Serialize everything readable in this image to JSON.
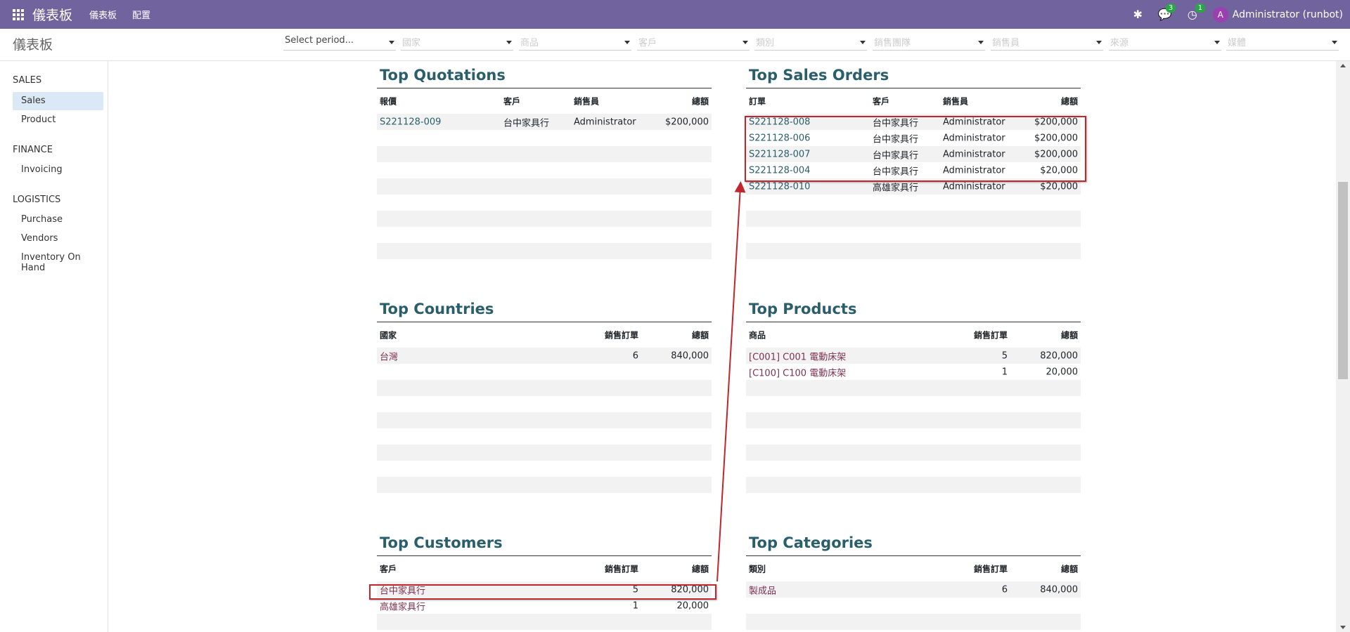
{
  "navbar": {
    "brand": "儀表板",
    "menu1": "儀表板",
    "menu2": "配置",
    "messages_count": "3",
    "activities_count": "1",
    "avatar_letter": "A",
    "user": "Administrator (runbot)"
  },
  "subbar": {
    "title": "儀表板",
    "filters": [
      "Select period...",
      "國家",
      "商品",
      "客戶",
      "類別",
      "銷售團隊",
      "銷售員",
      "來源",
      "媒體"
    ]
  },
  "sidebar": {
    "sections": [
      {
        "title": "SALES",
        "items": [
          "Sales",
          "Product"
        ]
      },
      {
        "title": "FINANCE",
        "items": [
          "Invoicing"
        ]
      },
      {
        "title": "LOGISTICS",
        "items": [
          "Purchase",
          "Vendors",
          "Inventory On Hand"
        ]
      }
    ]
  },
  "top_quotations": {
    "title": "Top Quotations",
    "headers": [
      "報價",
      "客戶",
      "銷售員",
      "總額"
    ],
    "rows": [
      [
        "S221128-009",
        "台中家具行",
        "Administrator",
        "$200,000"
      ]
    ]
  },
  "top_sales_orders": {
    "title": "Top Sales Orders",
    "headers": [
      "訂單",
      "客戶",
      "銷售員",
      "總額"
    ],
    "rows": [
      [
        "S221128-008",
        "台中家具行",
        "Administrator",
        "$200,000"
      ],
      [
        "S221128-006",
        "台中家具行",
        "Administrator",
        "$200,000"
      ],
      [
        "S221128-007",
        "台中家具行",
        "Administrator",
        "$200,000"
      ],
      [
        "S221128-004",
        "台中家具行",
        "Administrator",
        "$20,000"
      ],
      [
        "S221128-010",
        "高雄家具行",
        "Administrator",
        "$20,000"
      ]
    ]
  },
  "top_countries": {
    "title": "Top Countries",
    "headers": [
      "國家",
      "銷售訂單",
      "總額"
    ],
    "rows": [
      [
        "台灣",
        "6",
        "840,000"
      ]
    ]
  },
  "top_products": {
    "title": "Top Products",
    "headers": [
      "商品",
      "銷售訂單",
      "總額"
    ],
    "rows": [
      [
        "[C001] C001 電動床架",
        "5",
        "820,000"
      ],
      [
        "[C100] C100 電動床架",
        "1",
        "20,000"
      ]
    ]
  },
  "top_customers": {
    "title": "Top Customers",
    "headers": [
      "客戶",
      "銷售訂單",
      "總額"
    ],
    "rows": [
      [
        "台中家具行",
        "5",
        "820,000"
      ],
      [
        "高雄家具行",
        "1",
        "20,000"
      ]
    ]
  },
  "top_categories": {
    "title": "Top Categories",
    "headers": [
      "類別",
      "銷售訂單",
      "總額"
    ],
    "rows": [
      [
        "製成品",
        "6",
        "840,000"
      ]
    ]
  },
  "colors": {
    "navbar": "#71639e",
    "heading": "#2a5e6b",
    "link_plum": "#7c3150",
    "highlight_box": "#c0262d"
  }
}
